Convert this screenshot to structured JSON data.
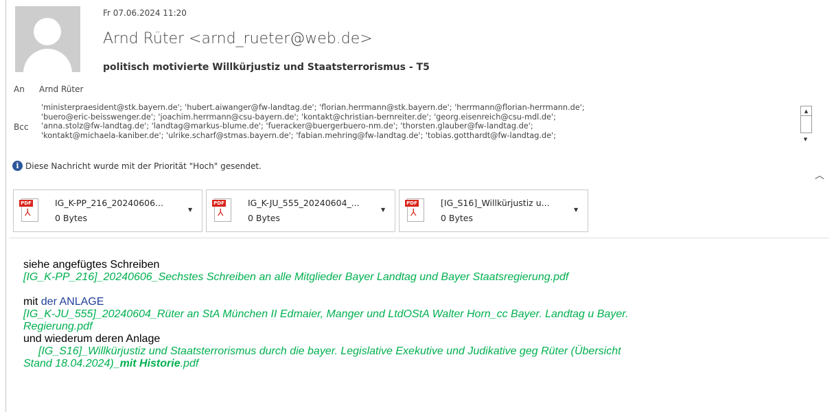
{
  "header": {
    "date": "Fr 07.06.2024 11:20",
    "sender": "Arnd Rüter <arnd_rueter@web.de>",
    "subject": "politisch motivierte Willkürjustiz und Staatsterrorismus - T5"
  },
  "recipients": {
    "to_label": "An",
    "to_value": "Arnd Rüter",
    "bcc_label": "Bcc",
    "bcc_lines": [
      "'ministerpraesident@stk.bayern.de'; 'hubert.aiwanger@fw-landtag.de'; 'florian.herrmann@stk.bayern.de'; 'herrmann@florian-herrmann.de';",
      "'buero@eric-beisswenger.de'; 'joachim.herrmann@csu-bayern.de'; 'kontakt@christian-bernreiter.de'; 'georg.eisenreich@csu-mdl.de';",
      "'anna.stolz@fw-landtag.de'; 'landtag@markus-blume.de'; 'fueracker@buergerbuero-nm.de'; 'thorsten.glauber@fw-landtag.de';",
      "'kontakt@michaela-kaniber.de'; 'ulrike.scharf@stmas.bayern.de'; 'fabian.mehring@fw-landtag.de'; 'tobias.gotthardt@fw-landtag.de';"
    ]
  },
  "info": {
    "icon": "info-icon",
    "text": "Diese Nachricht wurde mit der Priorität \"Hoch\" gesendet."
  },
  "attachments": [
    {
      "name": "IG_K-PP_216_20240606...",
      "size": "0 Bytes",
      "icon": "pdf-icon"
    },
    {
      "name": "IG_K-JU_555_20240604_...",
      "size": "0 Bytes",
      "icon": "pdf-icon"
    },
    {
      "name": "[IG_S16]_Willkürjustiz u...",
      "size": "0 Bytes",
      "icon": "pdf-icon"
    }
  ],
  "pdf_badge": "PDF",
  "body": {
    "line1": "siehe angefügtes Schreiben",
    "link1": "[IG_K-PP_216]_20240606_Sechstes Schreiben an alle Mitglieder Bayer Landtag und Bayer Staatsregierung.pdf",
    "mit": "mit",
    "anlage": "der ANLAGE",
    "link2a": "[IG_K-JU_555]_20240604_Rüter an StA München II Edmaier, Manger und LtdOStA Walter Horn_cc Bayer. Landtag u Bayer.",
    "link2b": "Regierung.pdf",
    "line3": "und wiederum deren Anlage",
    "link3a": "[IG_S16]_Willkürjustiz und Staatsterrorismus durch die bayer. Legislative Exekutive und Judikative geg Rüter (Übersicht",
    "link3b_plain": "Stand 18.04.2024)",
    "link3b_bold": "_mit Historie",
    "link3b_ext": ".pdf"
  },
  "colors": {
    "link_green": "#00b050",
    "anlage_blue": "#1f3f99",
    "pdf_red": "#d9241b",
    "info_blue": "#2b579a"
  }
}
